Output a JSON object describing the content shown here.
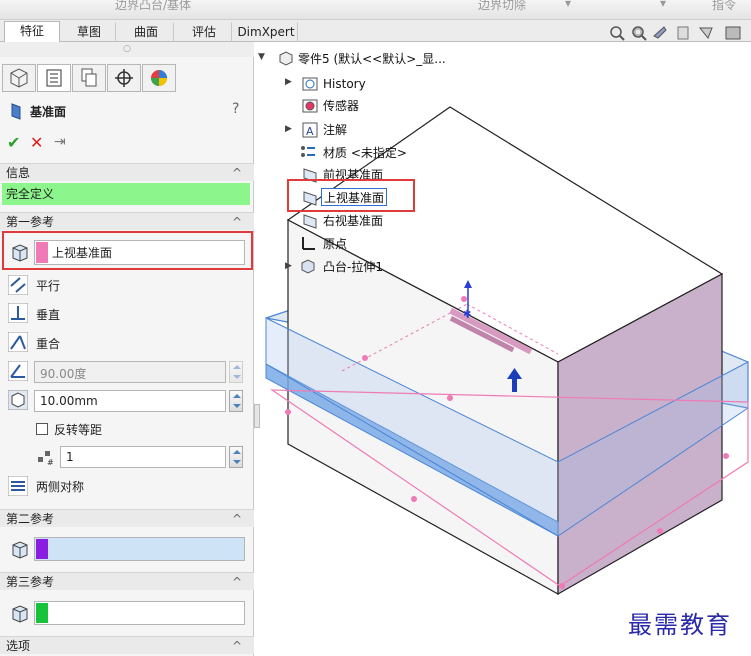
{
  "top_strip": {
    "item1": "边界凸台/基体",
    "item2": "边界切除",
    "item3": "指令"
  },
  "tabs": [
    "特征",
    "草图",
    "曲面",
    "评估",
    "DimXpert"
  ],
  "property_manager": {
    "title": "基准面",
    "help": "?",
    "ok": "✔",
    "cancel": "✕",
    "pin": "⇥",
    "info_header": "信息",
    "info_status": "完全定义",
    "first_ref_header": "第一参考",
    "first_ref_value": "上视基准面",
    "options": {
      "parallel": "平行",
      "perpendicular": "垂直",
      "coincident": "重合",
      "angle_value": "90.00度",
      "distance_value": "10.00mm",
      "flip_label": "反转等距",
      "count_value": "1",
      "symmetric": "两侧对称"
    },
    "second_ref_header": "第二参考",
    "third_ref_header": "第三参考",
    "options_header": "选项",
    "colors": {
      "first": "#f07ab6",
      "second": "#8a1ee0",
      "third": "#18c23a",
      "status_bg": "#8cf58c",
      "second_field_bg": "#cfe3f7"
    }
  },
  "tree": {
    "root": "零件5 (默认<<默认>_显...",
    "items": [
      "History",
      "传感器",
      "注解",
      "材质 <未指定>",
      "前视基准面",
      "上视基准面",
      "右视基准面",
      "原点",
      "凸台-拉伸1"
    ]
  },
  "watermark": "最需教育"
}
